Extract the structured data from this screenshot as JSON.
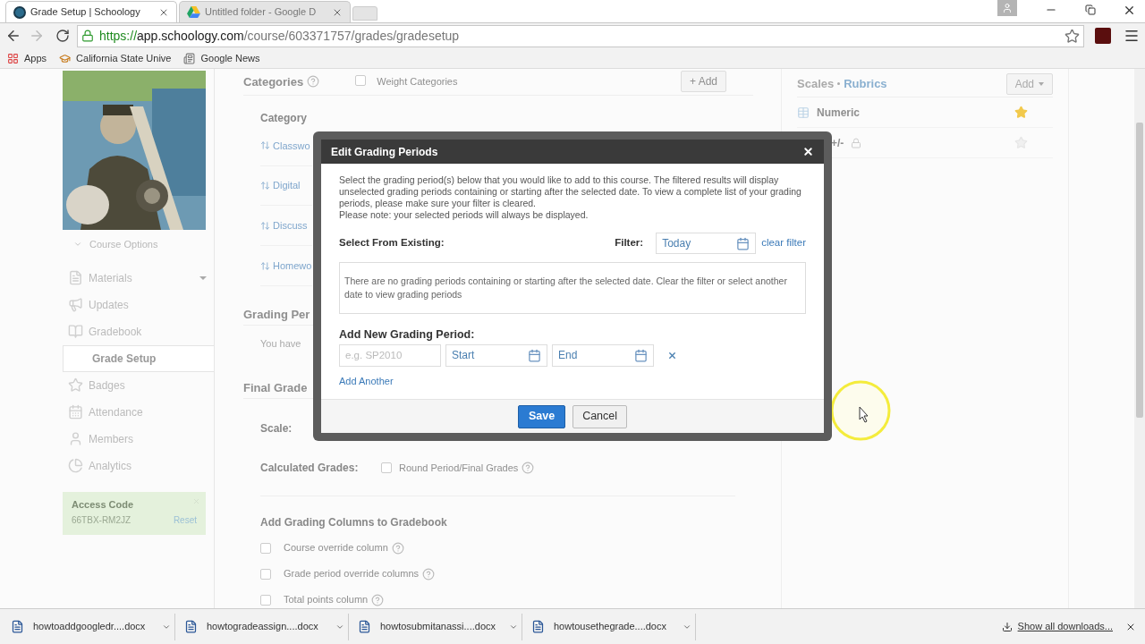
{
  "browser": {
    "tabs": [
      {
        "title": "Grade Setup | Schoology",
        "kind": "schoology",
        "selected": true
      },
      {
        "title": "Untitled folder - Google D",
        "kind": "drive",
        "selected": false
      }
    ],
    "url": {
      "scheme": "https://",
      "host": "app.schoology.com",
      "path": "/course/603371757/grades/gradesetup"
    },
    "bookmarks": [
      {
        "label": "Apps",
        "kind": "apps"
      },
      {
        "label": "California State Unive",
        "kind": "university"
      },
      {
        "label": "Google News",
        "kind": "news"
      }
    ]
  },
  "sidebar": {
    "course_options": "Course Options",
    "nav": [
      {
        "label": "Materials",
        "kind": "materials",
        "menu": true,
        "selected": false
      },
      {
        "label": "Updates",
        "kind": "updates",
        "menu": false,
        "selected": false
      },
      {
        "label": "Gradebook",
        "kind": "gradebook",
        "menu": false,
        "selected": false
      },
      {
        "label": "Grade Setup",
        "kind": "none",
        "menu": false,
        "selected": true
      },
      {
        "label": "Badges",
        "kind": "badges",
        "menu": false,
        "selected": false
      },
      {
        "label": "Attendance",
        "kind": "attendance",
        "menu": false,
        "selected": false
      },
      {
        "label": "Members",
        "kind": "members",
        "menu": false,
        "selected": false
      },
      {
        "label": "Analytics",
        "kind": "analytics",
        "menu": false,
        "selected": false
      }
    ],
    "access_code": {
      "title": "Access Code",
      "code": "66TBX-RM2JZ",
      "reset": "Reset"
    }
  },
  "categories": {
    "title": "Categories",
    "weight_label": "Weight Categories",
    "weight_checked": false,
    "add": "+ Add",
    "column": "Category",
    "items": [
      "Classwo",
      "Digital",
      "Discuss",
      "Homewo"
    ]
  },
  "grading_periods": {
    "title": "Grading Per",
    "text": "You have"
  },
  "final_grade": {
    "title": "Final Grade",
    "scale_label": "Scale:",
    "calculated_label": "Calculated Grades:",
    "round_label": "Round Period/Final Grades",
    "round_checked": false,
    "columns_title": "Add Grading Columns to Gradebook",
    "columns": [
      {
        "label": "Course override column",
        "checked": false
      },
      {
        "label": "Grade period override columns",
        "checked": false
      },
      {
        "label": "Total points column",
        "checked": false
      }
    ]
  },
  "scales": {
    "title": "Scales",
    "rubrics": "Rubrics",
    "add": "Add",
    "items": [
      {
        "label": "Numeric",
        "icon": true,
        "default": true,
        "locked": false
      },
      {
        "label": "+/-",
        "icon": false,
        "default": false,
        "locked": true
      }
    ]
  },
  "modal": {
    "title": "Edit Grading Periods",
    "intro": [
      "Select the grading period(s) below that you would like to add to this course. The filtered results will display unselected grading periods containing or starting after the selected date. To view a complete list of your grading periods, please make sure your filter is cleared.",
      "Please note: your selected periods will always be displayed."
    ],
    "select_label": "Select From Existing:",
    "filter_label": "Filter:",
    "filter_value": "Today",
    "clear_filter": "clear filter",
    "empty_message": "There are no grading periods containing or starting after the selected date. Clear the filter or select another date to view grading periods",
    "add_new_label": "Add New Grading Period:",
    "name_placeholder": "e.g. SP2010",
    "start_value": "Start",
    "end_value": "End",
    "add_another": "Add Another",
    "save": "Save",
    "cancel": "Cancel"
  },
  "downloads": {
    "files": [
      "howtoaddgoogledr....docx",
      "howtogradeassign....docx",
      "howtosubmitanassi....docx",
      "howtousethegrade....docx"
    ],
    "show_all": "Show all downloads..."
  }
}
